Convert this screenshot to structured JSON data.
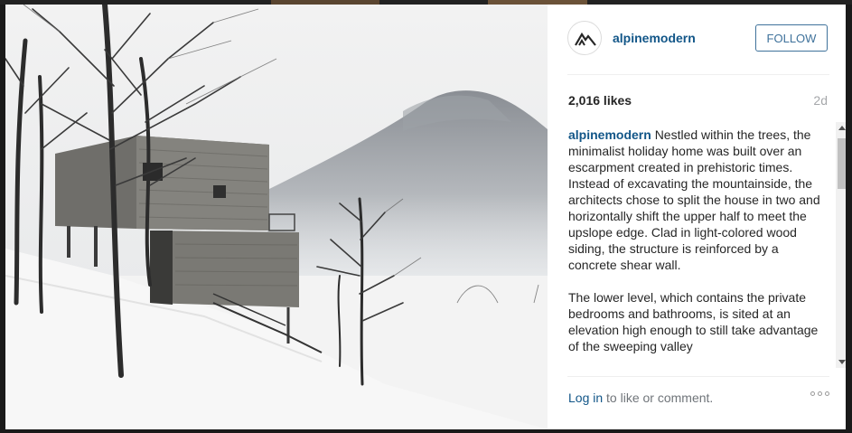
{
  "post": {
    "username": "alpinemodern",
    "follow_label": "FOLLOW",
    "likes": "2,016 likes",
    "time_ago": "2d",
    "caption_user": "alpinemodern",
    "caption_p1": "Nestled within the trees, the minimalist holiday home was built over an escarpment created in prehistoric times. Instead of excavating the mountainside, the architects chose to split the house in two and horizontally shift the upper half to meet the upslope edge. Clad in light-colored wood siding, the structure is reinforced by a concrete shear wall.",
    "caption_p2": "The lower level, which contains the private bedrooms and bathrooms, is sited at an elevation high enough to still take advantage of the sweeping valley",
    "login_label": "Log in",
    "footer_text": " to like or comment."
  },
  "icons": {
    "avatar": "mountain-logo-icon",
    "more": "more-options-icon",
    "scroll_up": "scroll-up-arrow-icon",
    "scroll_down": "scroll-down-arrow-icon"
  },
  "colors": {
    "link": "#125688",
    "follow": "#3f729b",
    "muted": "#a5a7aa"
  }
}
